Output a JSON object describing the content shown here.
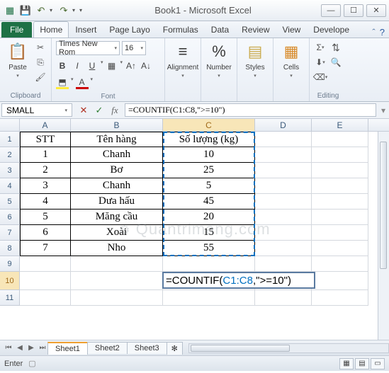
{
  "window": {
    "title": "Book1 - Microsoft Excel"
  },
  "qat": {
    "save": "💾",
    "undo": "↶",
    "redo": "↷"
  },
  "tabs": {
    "file": "File",
    "home": "Home",
    "insert": "Insert",
    "pagelayout": "Page Layo",
    "formulas": "Formulas",
    "data": "Data",
    "review": "Review",
    "view": "View",
    "developer": "Develope"
  },
  "ribbon": {
    "clipboard": {
      "label": "Clipboard",
      "paste": "Paste"
    },
    "font": {
      "label": "Font",
      "name": "Times New Rom",
      "size": "16"
    },
    "alignment": {
      "label": "Alignment",
      "btn": "Alignment"
    },
    "number": {
      "label": "Number",
      "btn": "Number"
    },
    "styles": {
      "label": "Styles",
      "btn": "Styles"
    },
    "cells": {
      "label": "Cells",
      "btn": "Cells"
    },
    "editing": {
      "label": "Editing"
    }
  },
  "namebox": "SMALL",
  "formula": "=COUNTIF(C1:C8,\">=10\")",
  "cols": [
    "A",
    "B",
    "C",
    "D",
    "E"
  ],
  "rows": [
    "1",
    "2",
    "3",
    "4",
    "5",
    "6",
    "7",
    "8",
    "9",
    "10",
    "11"
  ],
  "table": {
    "headers": {
      "stt": "STT",
      "ten": "Tên hàng",
      "sl": "Số lượng (kg)"
    },
    "data": [
      {
        "stt": "1",
        "ten": "Chanh",
        "sl": "10"
      },
      {
        "stt": "2",
        "ten": "Bơ",
        "sl": "25"
      },
      {
        "stt": "3",
        "ten": "Chanh",
        "sl": "5"
      },
      {
        "stt": "4",
        "ten": "Dưa hấu",
        "sl": "45"
      },
      {
        "stt": "5",
        "ten": "Măng cầu",
        "sl": "20"
      },
      {
        "stt": "6",
        "ten": "Xoài",
        "sl": "15"
      },
      {
        "stt": "7",
        "ten": "Nho",
        "sl": "55"
      }
    ]
  },
  "edit": {
    "fn": "=COUNTIF(",
    "ref": "C1:C8",
    "rest": ",\">=10\")"
  },
  "sheets": {
    "s1": "Sheet1",
    "s2": "Sheet2",
    "s3": "Sheet3"
  },
  "status": {
    "mode": "Enter"
  },
  "watermark": "Quantrimang.com",
  "chart_data": {
    "type": "table",
    "title": "",
    "columns": [
      "STT",
      "Tên hàng",
      "Số lượng (kg)"
    ],
    "rows": [
      [
        1,
        "Chanh",
        10
      ],
      [
        2,
        "Bơ",
        25
      ],
      [
        3,
        "Chanh",
        5
      ],
      [
        4,
        "Dưa hấu",
        45
      ],
      [
        5,
        "Măng cầu",
        20
      ],
      [
        6,
        "Xoài",
        15
      ],
      [
        7,
        "Nho",
        55
      ]
    ],
    "formula_cell": "C10",
    "formula": "=COUNTIF(C1:C8,\">=10\")"
  }
}
